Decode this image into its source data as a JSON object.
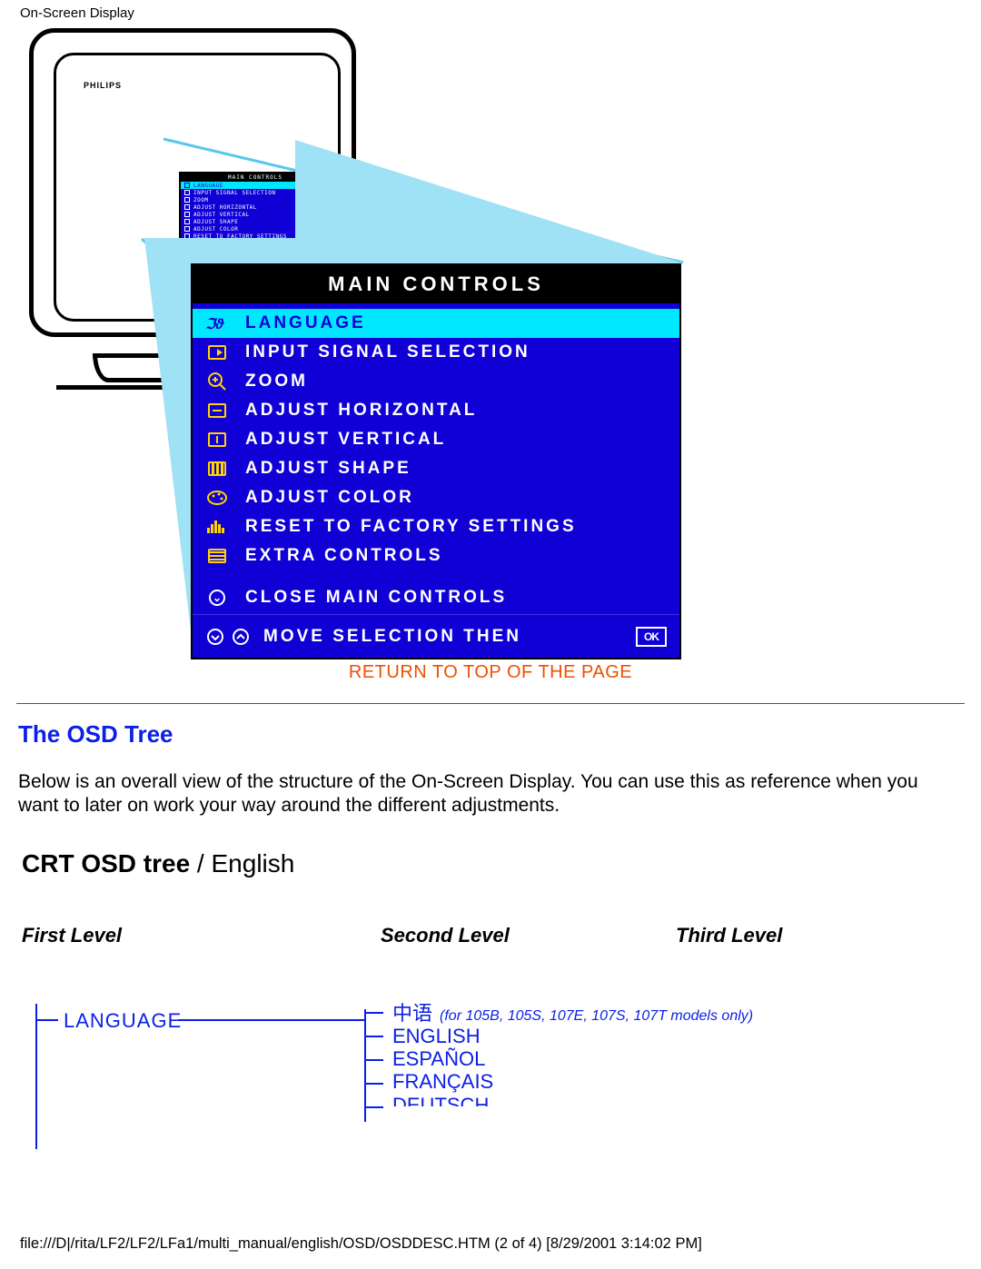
{
  "header": {
    "title": "On-Screen Display"
  },
  "osd": {
    "title": "Main Controls",
    "items": [
      {
        "label": "Language",
        "highlight": true,
        "icon": "language-icon"
      },
      {
        "label": "Input Signal Selection",
        "icon": "input-icon"
      },
      {
        "label": "Zoom",
        "icon": "zoom-icon"
      },
      {
        "label": "Adjust Horizontal",
        "icon": "horiz-icon"
      },
      {
        "label": "Adjust Vertical",
        "icon": "vert-icon"
      },
      {
        "label": "Adjust Shape",
        "icon": "shape-icon"
      },
      {
        "label": "Adjust Color",
        "icon": "color-icon"
      },
      {
        "label": "Reset to Factory Settings",
        "icon": "reset-icon"
      },
      {
        "label": "Extra Controls",
        "icon": "extra-icon"
      }
    ],
    "close_label": "Close Main Controls",
    "footer_text": "Move Selection Then",
    "footer_ok": "OK"
  },
  "return_link": "RETURN TO TOP OF THE PAGE",
  "section_heading": "The OSD Tree",
  "body_text": "Below is an overall view of the structure of the On-Screen Display. You can use this as reference when you want to later on work your way around the different adjustments.",
  "tree": {
    "title_bold": "CRT OSD tree",
    "title_sep": " / ",
    "title_lang": "English",
    "col1": "First Level",
    "col2": "Second Level",
    "col3": "Third Level",
    "l1": "LANGUAGE",
    "l2": [
      {
        "label": "中语",
        "note": "(for 105B, 105S, 107E, 107S, 107T models only)"
      },
      {
        "label": "ENGLISH"
      },
      {
        "label": "ESPAÑOL"
      },
      {
        "label": "FRANÇAIS"
      },
      {
        "label": "DEUTSCH"
      }
    ]
  },
  "footer_path": "file:///D|/rita/LF2/LF2/LFa1/multi_manual/english/OSD/OSDDESC.HTM (2 of 4) [8/29/2001 3:14:02 PM]"
}
